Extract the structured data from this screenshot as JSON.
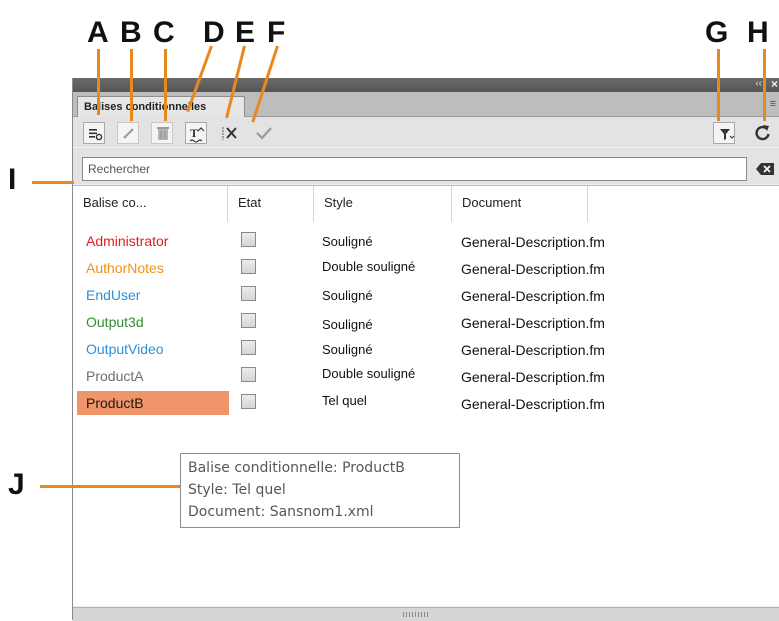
{
  "callouts": [
    "A",
    "B",
    "C",
    "D",
    "E",
    "F",
    "G",
    "H",
    "I",
    "J"
  ],
  "panel": {
    "tab_label": "Balises conditionnelles",
    "collapse_glyph": "‹‹",
    "close_glyph": "×",
    "menu_glyph": "≡"
  },
  "toolbar": {
    "left_buttons": [
      "conditional-tag-settings-icon",
      "edit-pencil-icon",
      "delete-trash-icon",
      "apply-format-icon",
      "remove-tag-icon",
      "apply-checkmark-icon"
    ],
    "right_buttons": [
      "filter-icon",
      "refresh-icon"
    ]
  },
  "search": {
    "placeholder": "Rechercher"
  },
  "table": {
    "columns": [
      "Balise co...",
      "Etat",
      "Style",
      "Document"
    ],
    "rows": [
      {
        "name": "Administrator",
        "color": "#e31c1c",
        "style": "Souligné",
        "document": "General-Description.fm"
      },
      {
        "name": "AuthorNotes",
        "color": "#f0901e",
        "style": "Double souligné",
        "document": "General-Description.fm"
      },
      {
        "name": "EndUser",
        "color": "#2e8fd8",
        "style": "Souligné",
        "document": "General-Description.fm"
      },
      {
        "name": "Output3d",
        "color": "#2f8f2f",
        "style": "Souligné",
        "document": "General-Description.fm"
      },
      {
        "name": "OutputVideo",
        "color": "#2e8fd8",
        "style": "Souligné",
        "document": "General-Description.fm"
      },
      {
        "name": "ProductA",
        "color": "#6e6e6e",
        "style": "Double souligné",
        "document": "General-Description.fm"
      },
      {
        "name": "ProductB",
        "color": "#1a1a1a",
        "style": "Tel quel",
        "document": "General-Description.fm",
        "selected": true,
        "highlight": "#f0956a"
      }
    ]
  },
  "tooltip": {
    "line1": "Balise conditionnelle: ProductB",
    "line2": "Style: Tel quel",
    "line3": "Document: Sansnom1.xml"
  },
  "colors": {
    "callout_line": "#e8891d",
    "selected_row": "#f0956a"
  }
}
